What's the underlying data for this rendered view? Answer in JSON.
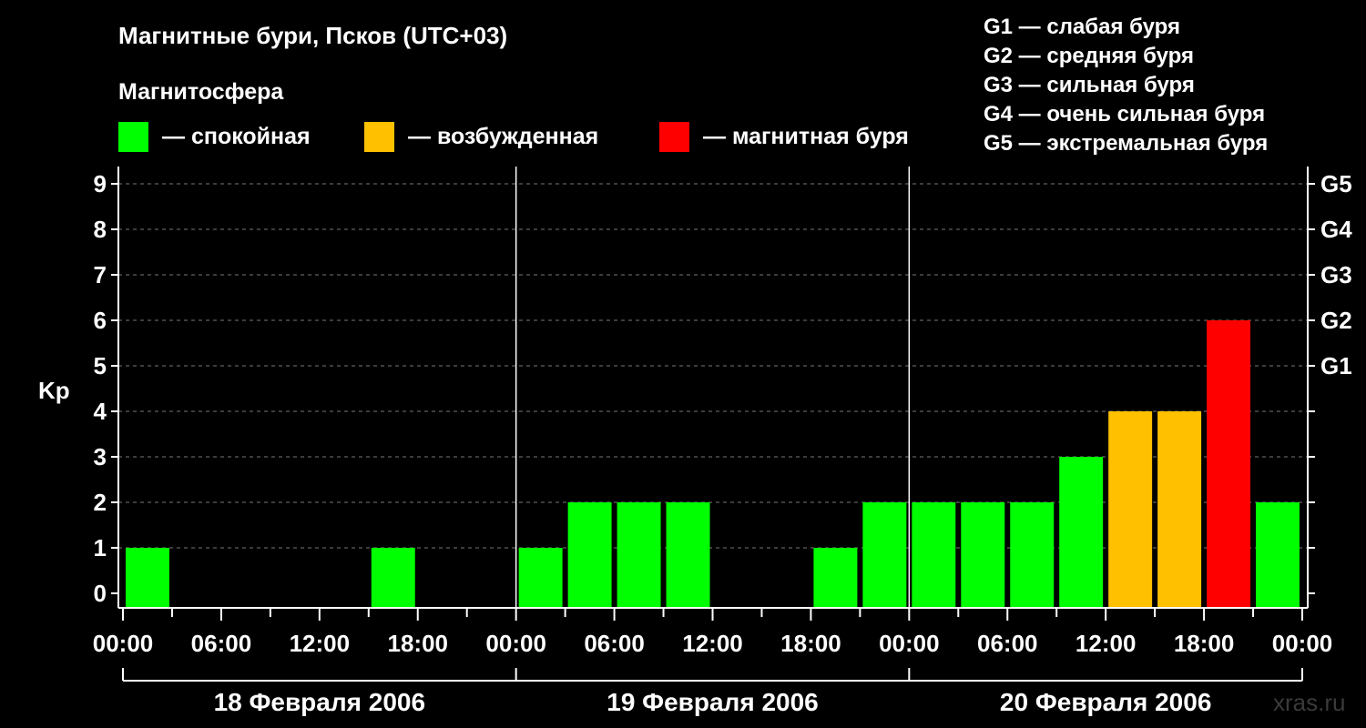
{
  "title": "Магнитные бури, Псков (UTC+03)",
  "subtitle": "Магнитосфера",
  "legend": [
    {
      "label": "— спокойная",
      "color": "#00ff00"
    },
    {
      "label": "— возбужденная",
      "color": "#ffc000"
    },
    {
      "label": "— магнитная буря",
      "color": "#ff0000"
    }
  ],
  "g_legend": [
    "G1 — слабая буря",
    "G2 — средняя буря",
    "G3 — сильная буря",
    "G4 — очень сильная буря",
    "G5 — экстремальная буря"
  ],
  "watermark": "xras.ru",
  "chart_data": {
    "type": "bar",
    "ylabel": "Kp",
    "ylim": [
      0,
      9
    ],
    "y_ticks": [
      "0",
      "1",
      "2",
      "3",
      "4",
      "5",
      "6",
      "7",
      "8",
      "9"
    ],
    "g_ticks": [
      {
        "kp": 5,
        "label": "G1"
      },
      {
        "kp": 6,
        "label": "G2"
      },
      {
        "kp": 7,
        "label": "G3"
      },
      {
        "kp": 8,
        "label": "G4"
      },
      {
        "kp": 9,
        "label": "G5"
      }
    ],
    "x_tick_labels": [
      "00:00",
      "06:00",
      "12:00",
      "18:00",
      "00:00",
      "06:00",
      "12:00",
      "18:00",
      "00:00",
      "06:00",
      "12:00",
      "18:00",
      "00:00"
    ],
    "days": [
      "18 Февраля 2006",
      "19 Февраля 2006",
      "20 Февраля 2006"
    ],
    "interval_hours": 3,
    "values": [
      1,
      0,
      0,
      0,
      0,
      1,
      0,
      0,
      1,
      2,
      2,
      2,
      0,
      0,
      1,
      2,
      2,
      2,
      2,
      3,
      4,
      4,
      6,
      2
    ],
    "colors": {
      "quiet": "#00ff00",
      "active": "#ffc000",
      "storm": "#ff0000"
    },
    "grid": true
  }
}
